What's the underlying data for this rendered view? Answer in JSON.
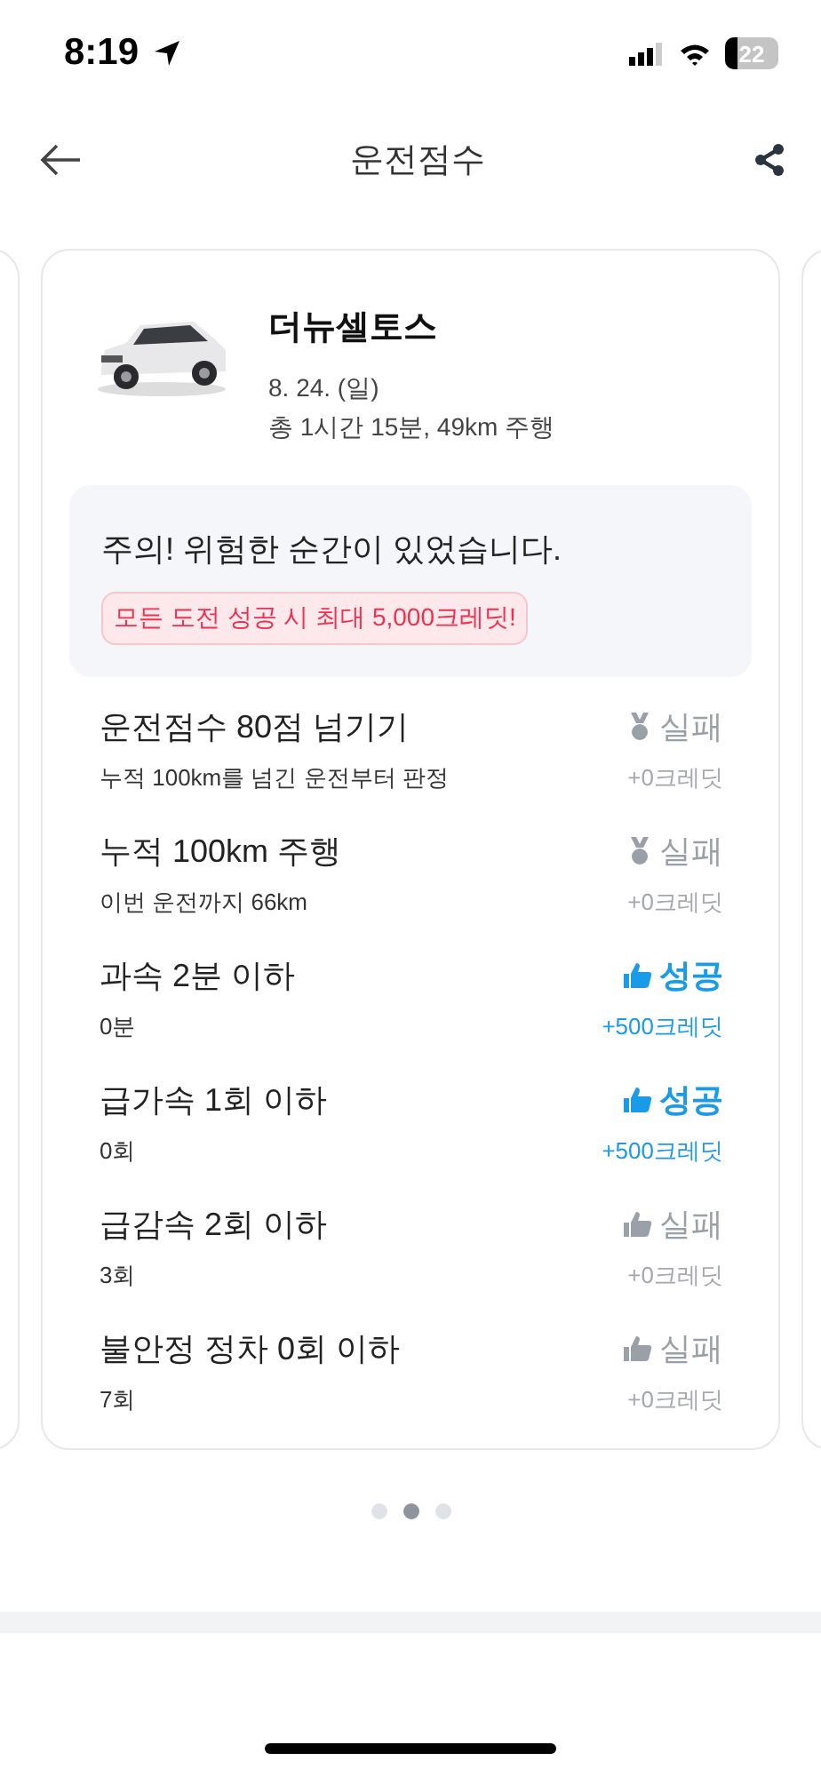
{
  "status_bar": {
    "time": "8:19",
    "battery": "22"
  },
  "header": {
    "title": "운전점수"
  },
  "trip": {
    "car_name": "더뉴셀토스",
    "date": "8. 24. (일)",
    "summary": "총 1시간 15분, 49km 주행"
  },
  "notice": {
    "message": "주의! 위험한 순간이 있었습니다.",
    "badge": "모든 도전 성공 시 최대 5,000크레딧!"
  },
  "challenges": [
    {
      "title": "운전점수 80점 넘기기",
      "detail": "누적 100km를 넘긴 운전부터 판정",
      "kind": "medal",
      "success": false,
      "result": "실패",
      "credit": "+0크레딧"
    },
    {
      "title": "누적 100km 주행",
      "detail": "이번 운전까지 66km",
      "kind": "medal",
      "success": false,
      "result": "실패",
      "credit": "+0크레딧"
    },
    {
      "title": "과속 2분 이하",
      "detail": "0분",
      "kind": "thumb",
      "success": true,
      "result": "성공",
      "credit": "+500크레딧"
    },
    {
      "title": "급가속 1회 이하",
      "detail": "0회",
      "kind": "thumb",
      "success": true,
      "result": "성공",
      "credit": "+500크레딧"
    },
    {
      "title": "급감속 2회 이하",
      "detail": "3회",
      "kind": "thumb",
      "success": false,
      "result": "실패",
      "credit": "+0크레딧"
    },
    {
      "title": "불안정 정차 0회 이하",
      "detail": "7회",
      "kind": "thumb",
      "success": false,
      "result": "실패",
      "credit": "+0크레딧"
    }
  ],
  "pager": [
    {
      "selected": false
    },
    {
      "selected": true
    },
    {
      "selected": false
    }
  ]
}
